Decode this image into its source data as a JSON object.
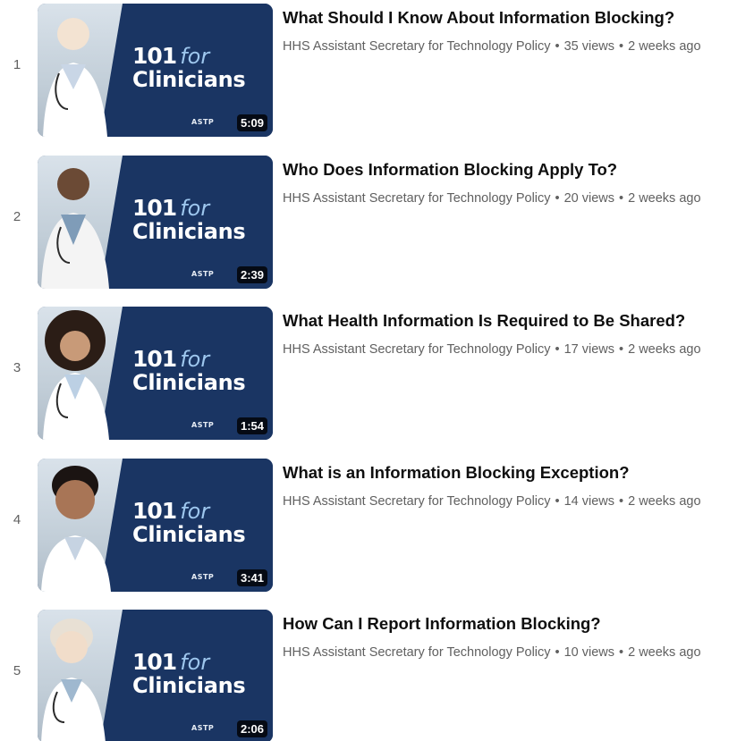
{
  "thumbnail": {
    "brand_number": "101",
    "brand_for": "for",
    "brand_word": "Clinicians",
    "logo_text": "ASTP",
    "colors": {
      "panel": "#1a3563",
      "accent": "#9ec7ee"
    }
  },
  "videos": [
    {
      "index": "1",
      "title": "What Should I Know About Information Blocking?",
      "channel": "HHS Assistant Secretary for Technology Policy",
      "views": "35 views",
      "age": "2 weeks ago",
      "duration": "5:09"
    },
    {
      "index": "2",
      "title": "Who Does Information Blocking Apply To?",
      "channel": "HHS Assistant Secretary for Technology Policy",
      "views": "20 views",
      "age": "2 weeks ago",
      "duration": "2:39"
    },
    {
      "index": "3",
      "title": "What Health Information Is Required to Be Shared?",
      "channel": "HHS Assistant Secretary for Technology Policy",
      "views": "17 views",
      "age": "2 weeks ago",
      "duration": "1:54"
    },
    {
      "index": "4",
      "title": "What is an Information Blocking Exception?",
      "channel": "HHS Assistant Secretary for Technology Policy",
      "views": "14 views",
      "age": "2 weeks ago",
      "duration": "3:41"
    },
    {
      "index": "5",
      "title": "How Can I Report Information Blocking?",
      "channel": "HHS Assistant Secretary for Technology Policy",
      "views": "10 views",
      "age": "2 weeks ago",
      "duration": "2:06"
    }
  ]
}
